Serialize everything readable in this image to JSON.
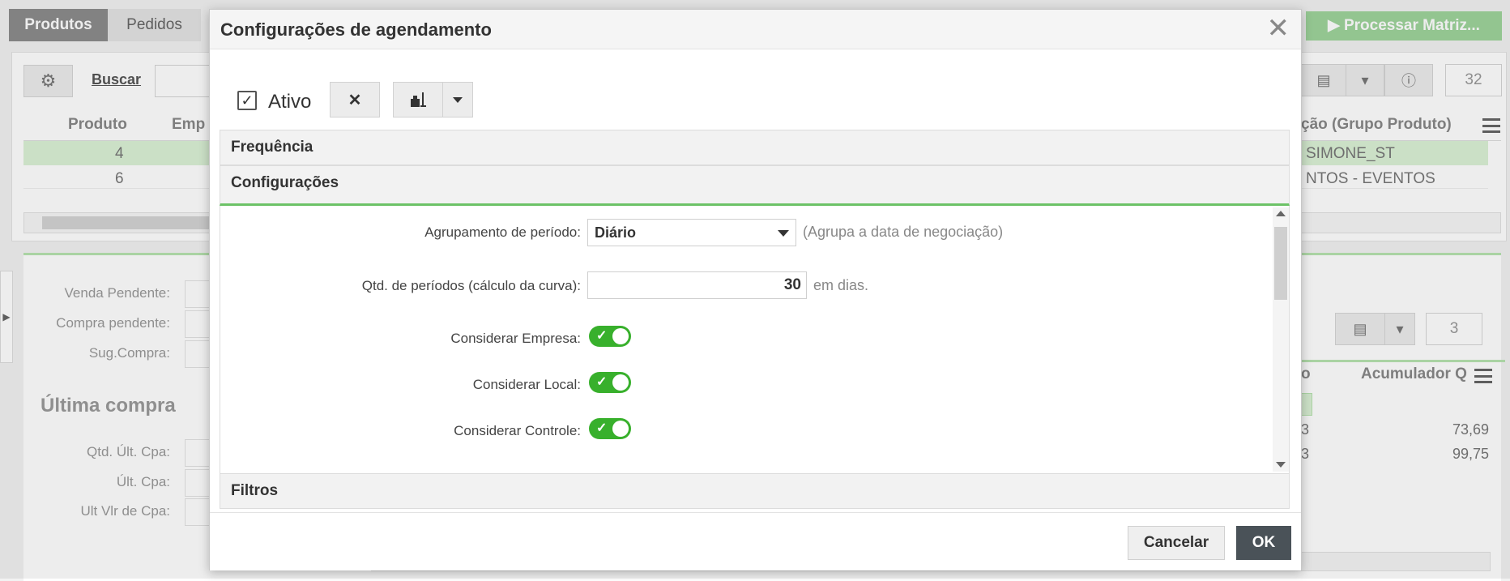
{
  "app": {
    "tabs": [
      {
        "label": "Produtos",
        "active": true
      },
      {
        "label": "Pedidos",
        "active": false
      }
    ],
    "process_button": "Processar Matriz...",
    "toolbar": {
      "search_link": "Buscar",
      "record_count": "32"
    },
    "grid": {
      "headers": [
        "Produto",
        "Emp",
        "ção (Grupo Produto)"
      ],
      "rows": [
        {
          "produto": "4",
          "grupo": "SIMONE_ST",
          "selected": true
        },
        {
          "produto": "6",
          "grupo": "NTOS - EVENTOS",
          "selected": false
        }
      ]
    },
    "details": {
      "labels": [
        "Venda Pendente:",
        "Compra pendente:",
        "Sug.Compra:"
      ],
      "section_title": "Última compra",
      "last_labels": [
        "Qtd. Últ. Cpa:",
        "Últ. Cpa:",
        "Ult Vlr de Cpa:"
      ]
    },
    "subgrid": {
      "record_count": "3",
      "headers": [
        "o",
        "Acumulador Q"
      ],
      "rows": [
        {
          "c1": "3",
          "acumulador": "73,69"
        },
        {
          "c1": "3",
          "acumulador": "99,75"
        }
      ]
    }
  },
  "modal": {
    "title": "Configurações de agendamento",
    "active_label": "Ativo",
    "active_checked": true,
    "sections": {
      "frequency": "Frequência",
      "settings": "Configurações",
      "filters": "Filtros"
    },
    "fields": {
      "period_grouping": {
        "label": "Agrupamento de período:",
        "value": "Diário",
        "hint": "(Agrupa a data de negociação)"
      },
      "period_count": {
        "label": "Qtd. de períodos (cálculo da curva):",
        "value": "30",
        "suffix": "em dias."
      },
      "consider_company": {
        "label": "Considerar Empresa:",
        "on": true
      },
      "consider_location": {
        "label": "Considerar Local:",
        "on": true
      },
      "consider_control": {
        "label": "Considerar Controle:",
        "on": true
      }
    },
    "buttons": {
      "cancel": "Cancelar",
      "ok": "OK"
    }
  },
  "colors": {
    "accent_green": "#6cc267",
    "toggle_on": "#38b02c",
    "primary_dark": "#4a5258",
    "process_green": "#9fd49b"
  }
}
